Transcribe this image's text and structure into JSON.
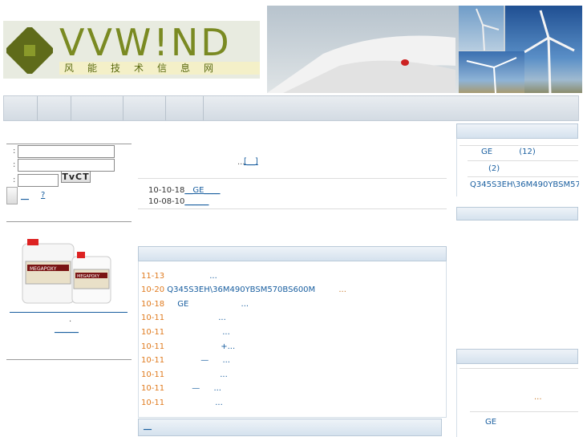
{
  "header": {
    "logo_text": "VVW!ND",
    "logo_subtitle": "风能技术信息网"
  },
  "colors": {
    "accent_orange": "#e07b1f",
    "link_blue": "#1a5fa0",
    "logo_green": "#7a8a22"
  },
  "login": {
    "field_label_user": ":",
    "field_label_pass": ":",
    "field_label_code": ":",
    "captcha_text": "TvCT",
    "register_link": "__",
    "forgot_link": "?"
  },
  "product": {
    "caption_line1": ".",
    "link": "______"
  },
  "notice": {
    "text": "...",
    "link": "[__]"
  },
  "updates": [
    {
      "date": "10-10-18",
      "title": "__GE____"
    },
    {
      "date": "10-08-10",
      "title": "______"
    }
  ],
  "news": [
    {
      "date": "11-13",
      "title": "...",
      "prefix": ""
    },
    {
      "date": "10-20",
      "title": "Q345S3EH\\36M490YBSM570BS600M",
      "suffix": "..."
    },
    {
      "date": "10-18",
      "title": "GE",
      "suffix": "..."
    },
    {
      "date": "10-11",
      "title": "",
      "suffix": "..."
    },
    {
      "date": "10-11",
      "title": "",
      "suffix": "..."
    },
    {
      "date": "10-11",
      "title": "",
      "suffix": "+..."
    },
    {
      "date": "10-11",
      "title": "—",
      "suffix": "..."
    },
    {
      "date": "10-11",
      "title": "",
      "suffix": "..."
    },
    {
      "date": "10-11",
      "title": "—",
      "suffix": "..."
    },
    {
      "date": "10-11",
      "title": "",
      "suffix": "..."
    }
  ],
  "bottom_tab": "__",
  "right": {
    "item1_label": "GE",
    "item1_count": "(12)",
    "item2_count": "(2)",
    "item3_label": "Q345S3EH\\36M490YBSM570",
    "box3_ellipsis": "...",
    "box3_item": "GE"
  }
}
